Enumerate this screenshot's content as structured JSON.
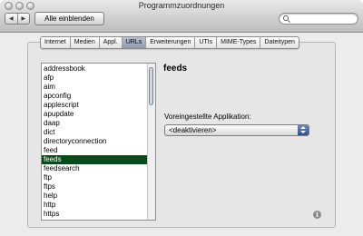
{
  "window": {
    "title": "Programmzuordnungen"
  },
  "toolbar": {
    "back_icon": "◀",
    "forward_icon": "▶",
    "show_all_label": "Alle einblenden",
    "search": {
      "value": "",
      "placeholder": ""
    }
  },
  "tabs": [
    {
      "label": "Internet",
      "active": false
    },
    {
      "label": "Medien",
      "active": false
    },
    {
      "label": "Appl.",
      "active": false
    },
    {
      "label": "URLs",
      "active": true
    },
    {
      "label": "Erweiterungen",
      "active": false
    },
    {
      "label": "UTIs",
      "active": false
    },
    {
      "label": "MIME-Types",
      "active": false
    },
    {
      "label": "Dateitypen",
      "active": false
    }
  ],
  "url_list": {
    "items": [
      "addressbook",
      "afp",
      "aim",
      "apconfig",
      "applescript",
      "apupdate",
      "daap",
      "dict",
      "directoryconnection",
      "feed",
      "feeds",
      "feedsearch",
      "ftp",
      "ftps",
      "help",
      "http",
      "https"
    ],
    "selected": "feeds"
  },
  "detail": {
    "heading": "feeds",
    "app_label": "Voreingestellte Applikation:",
    "app_value": "<deaktivieren>"
  },
  "info_icon": "i"
}
